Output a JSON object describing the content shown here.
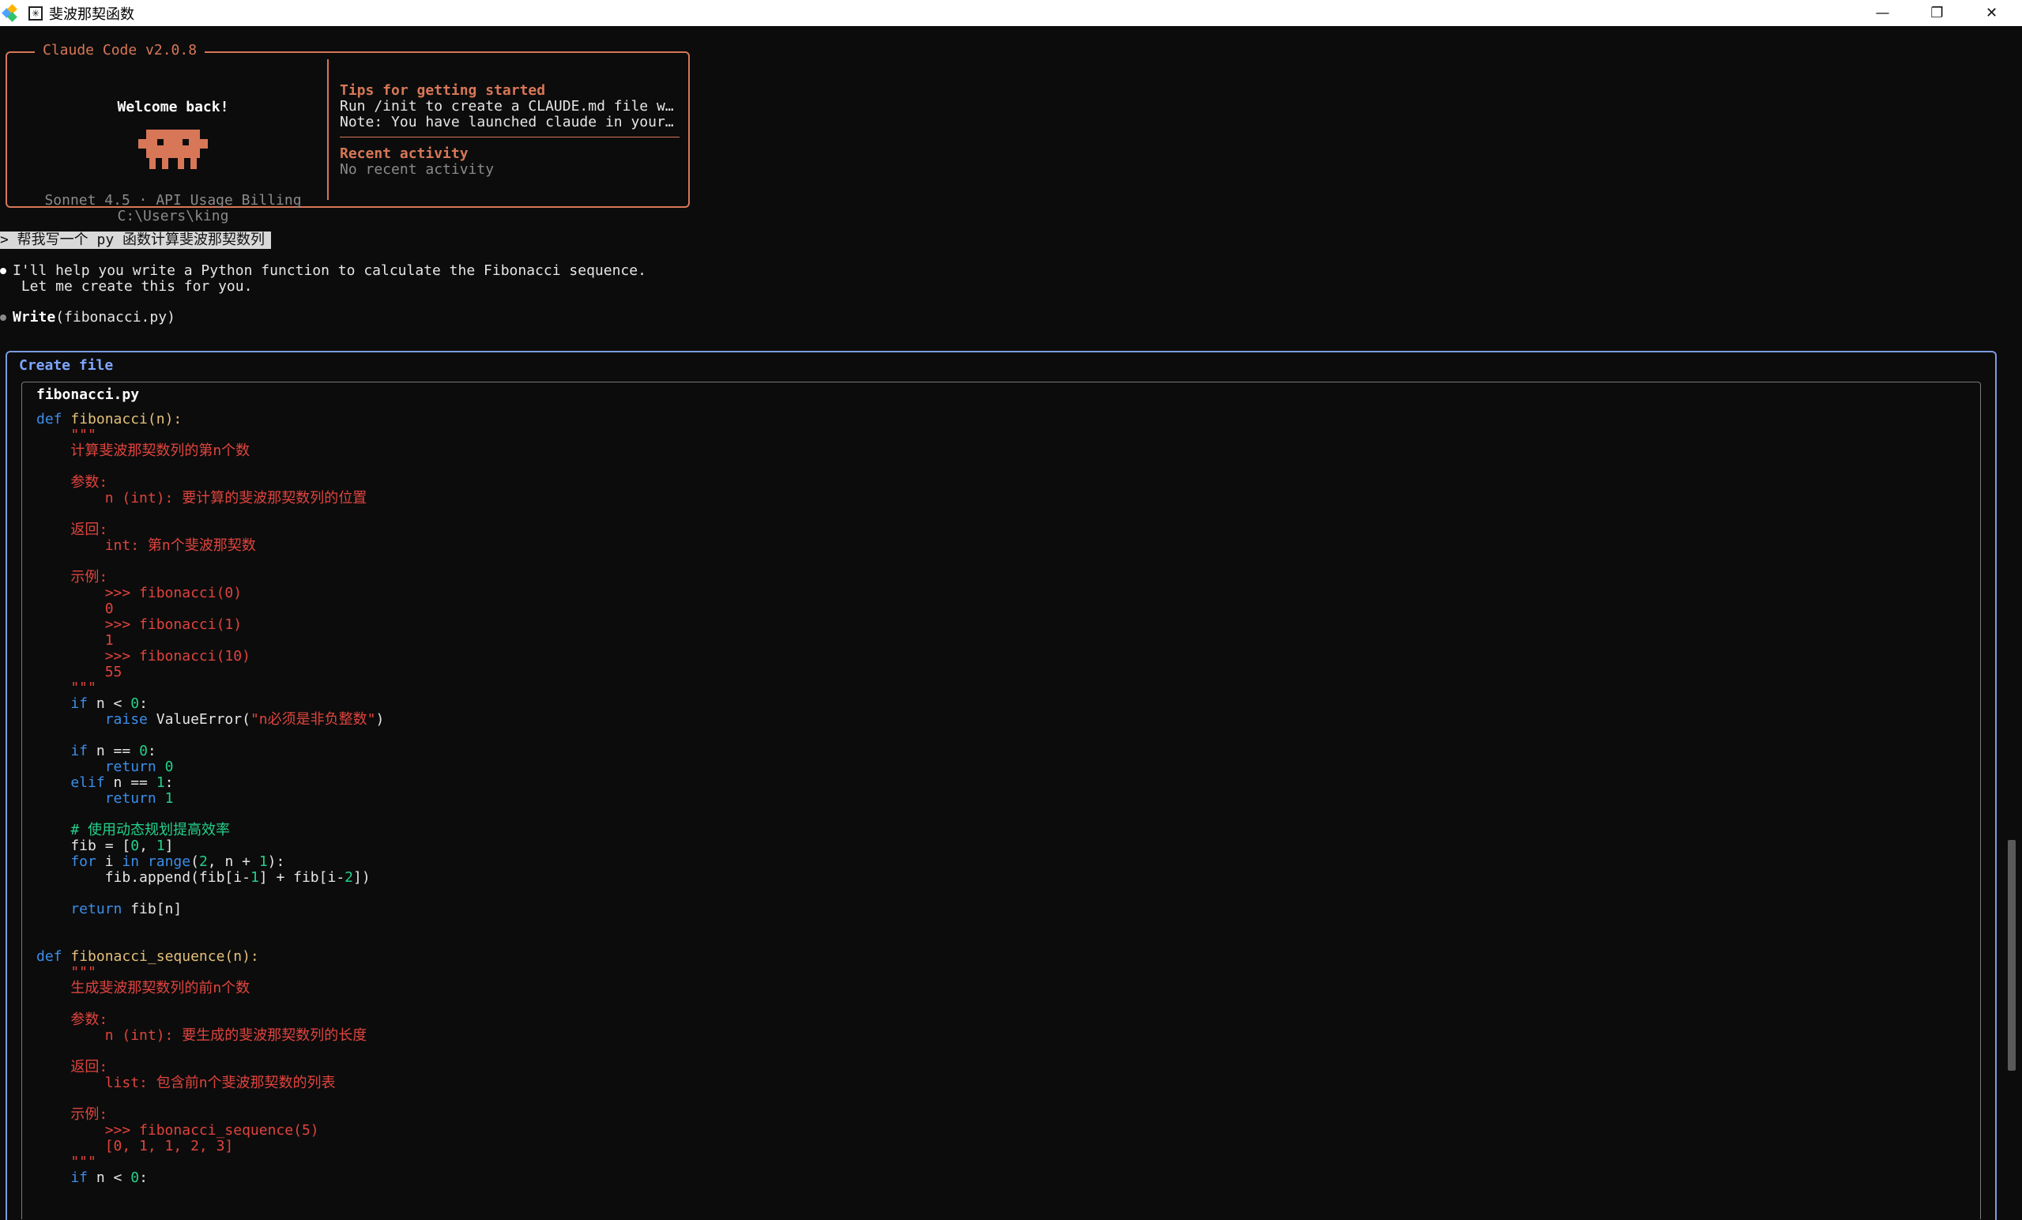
{
  "window": {
    "title": "斐波那契函数",
    "tab_icon_glyph": "✳",
    "minimize_glyph": "—",
    "restore_glyph": "❐",
    "close_glyph": "✕"
  },
  "welcome": {
    "version_label": "Claude Code v2.0.8",
    "greeting": "Welcome back!",
    "model_info": "Sonnet 4.5 · API Usage Billing",
    "cwd": "C:\\Users\\king",
    "tips_title": "Tips for getting started",
    "tips_line1": "Run /init to create a CLAUDE.md file w…",
    "tips_line2": "Note: You have launched claude in your…",
    "recent_title": "Recent activity",
    "recent_value": "No recent activity"
  },
  "conversation": {
    "user_prompt": "> 帮我写一个 py 函数计算斐波那契数列",
    "assistant_line1": "I'll help you write a Python function to calculate the Fibonacci sequence.",
    "assistant_line2": " Let me create this for you.",
    "tool_name": "Write",
    "tool_args": "(fibonacci.py)"
  },
  "create_file": {
    "label": "Create file",
    "filename": "fibonacci.py"
  },
  "code_lines": [
    [
      [
        "kw",
        "def "
      ],
      [
        "fn",
        "fibonacci(n):"
      ]
    ],
    [
      [
        "str",
        "    \"\"\""
      ]
    ],
    [
      [
        "str",
        "    计算斐波那契数列的第n个数"
      ]
    ],
    [],
    [
      [
        "str",
        "    参数:"
      ]
    ],
    [
      [
        "str",
        "        n (int): 要计算的斐波那契数列的位置"
      ]
    ],
    [],
    [
      [
        "str",
        "    返回:"
      ]
    ],
    [
      [
        "str",
        "        int: 第n个斐波那契数"
      ]
    ],
    [],
    [
      [
        "str",
        "    示例:"
      ]
    ],
    [
      [
        "str",
        "        >>> fibonacci(0)"
      ]
    ],
    [
      [
        "str",
        "        0"
      ]
    ],
    [
      [
        "str",
        "        >>> fibonacci(1)"
      ]
    ],
    [
      [
        "str",
        "        1"
      ]
    ],
    [
      [
        "str",
        "        >>> fibonacci(10)"
      ]
    ],
    [
      [
        "str",
        "        55"
      ]
    ],
    [
      [
        "str",
        "    \"\"\""
      ]
    ],
    [
      [
        "kw",
        "    if"
      ],
      [
        "dflt",
        " n < "
      ],
      [
        "num",
        "0"
      ],
      [
        "dflt",
        ":"
      ]
    ],
    [
      [
        "kw",
        "        raise"
      ],
      [
        "dflt",
        " ValueError("
      ],
      [
        "str",
        "\"n必须是非负整数\""
      ],
      [
        "dflt",
        ")"
      ]
    ],
    [],
    [
      [
        "kw",
        "    if"
      ],
      [
        "dflt",
        " n == "
      ],
      [
        "num",
        "0"
      ],
      [
        "dflt",
        ":"
      ]
    ],
    [
      [
        "kw",
        "        return "
      ],
      [
        "num",
        "0"
      ]
    ],
    [
      [
        "kw",
        "    elif"
      ],
      [
        "dflt",
        " n == "
      ],
      [
        "num",
        "1"
      ],
      [
        "dflt",
        ":"
      ]
    ],
    [
      [
        "kw",
        "        return "
      ],
      [
        "num",
        "1"
      ]
    ],
    [],
    [
      [
        "cmt",
        "    # 使用动态规划提高效率"
      ]
    ],
    [
      [
        "dflt",
        "    fib = ["
      ],
      [
        "num",
        "0"
      ],
      [
        "dflt",
        ", "
      ],
      [
        "num",
        "1"
      ],
      [
        "dflt",
        "]"
      ]
    ],
    [
      [
        "kw",
        "    for"
      ],
      [
        "dflt",
        " i "
      ],
      [
        "kw",
        "in"
      ],
      [
        "dflt",
        " "
      ],
      [
        "kw",
        "range"
      ],
      [
        "dflt",
        "("
      ],
      [
        "num",
        "2"
      ],
      [
        "dflt",
        ", n + "
      ],
      [
        "num",
        "1"
      ],
      [
        "dflt",
        "):"
      ]
    ],
    [
      [
        "dflt",
        "        fib.append(fib[i-"
      ],
      [
        "num",
        "1"
      ],
      [
        "dflt",
        "] + fib[i-"
      ],
      [
        "num",
        "2"
      ],
      [
        "dflt",
        "])"
      ]
    ],
    [],
    [
      [
        "kw",
        "    return"
      ],
      [
        "dflt",
        " fib[n]"
      ]
    ],
    [],
    [],
    [
      [
        "kw",
        "def "
      ],
      [
        "fn",
        "fibonacci_sequence(n):"
      ]
    ],
    [
      [
        "str",
        "    \"\"\""
      ]
    ],
    [
      [
        "str",
        "    生成斐波那契数列的前n个数"
      ]
    ],
    [],
    [
      [
        "str",
        "    参数:"
      ]
    ],
    [
      [
        "str",
        "        n (int): 要生成的斐波那契数列的长度"
      ]
    ],
    [],
    [
      [
        "str",
        "    返回:"
      ]
    ],
    [
      [
        "str",
        "        list: 包含前n个斐波那契数的列表"
      ]
    ],
    [],
    [
      [
        "str",
        "    示例:"
      ]
    ],
    [
      [
        "str",
        "        >>> fibonacci_sequence(5)"
      ]
    ],
    [
      [
        "str",
        "        [0, 1, 1, 2, 3]"
      ]
    ],
    [
      [
        "str",
        "    \"\"\""
      ]
    ],
    [
      [
        "kw",
        "    if"
      ],
      [
        "dflt",
        " n < "
      ],
      [
        "num",
        "0"
      ],
      [
        "dflt",
        ":"
      ]
    ]
  ],
  "colors": {
    "claude_orange": "#d77757",
    "create_file_border": "#7b9be0",
    "keyword": "#3b8eea",
    "function_name": "#e5c07b",
    "string": "#e0443e",
    "number": "#23d18b"
  }
}
